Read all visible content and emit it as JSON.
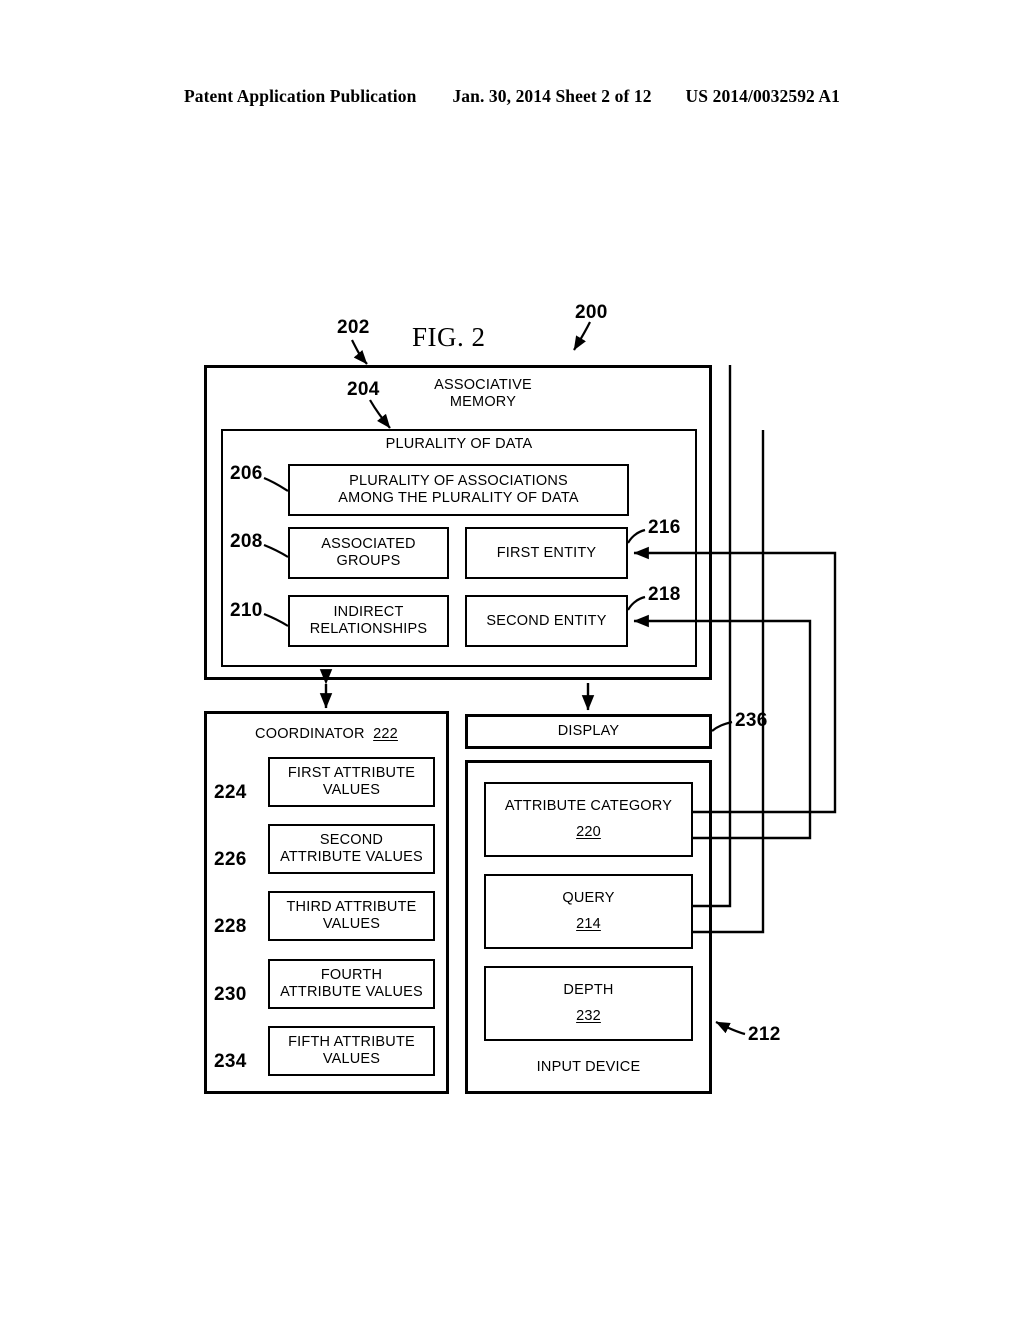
{
  "header": {
    "publication": "Patent Application Publication",
    "date_sheet": "Jan. 30, 2014  Sheet 2 of 12",
    "patent_number": "US 2014/0032592 A1"
  },
  "figure": {
    "title": "FIG. 2",
    "system_ref": "200",
    "outer_ref": "202"
  },
  "memory": {
    "ref": "204",
    "title": "ASSOCIATIVE\nMEMORY",
    "data_title": "PLURALITY OF DATA",
    "associations": {
      "ref": "206",
      "label": "PLURALITY OF ASSOCIATIONS\nAMONG THE PLURALITY OF DATA"
    },
    "associated_groups": {
      "ref": "208",
      "label": "ASSOCIATED\nGROUPS"
    },
    "indirect_relationships": {
      "ref": "210",
      "label": "INDIRECT\nRELATIONSHIPS"
    },
    "first_entity": {
      "ref": "216",
      "label": "FIRST ENTITY"
    },
    "second_entity": {
      "ref": "218",
      "label": "SECOND ENTITY"
    }
  },
  "coordinator": {
    "title": "COORDINATOR",
    "ref": "222",
    "attributes": [
      {
        "ref": "224",
        "label": "FIRST ATTRIBUTE\nVALUES"
      },
      {
        "ref": "226",
        "label": "SECOND\nATTRIBUTE VALUES"
      },
      {
        "ref": "228",
        "label": "THIRD ATTRIBUTE\nVALUES"
      },
      {
        "ref": "230",
        "label": "FOURTH\nATTRIBUTE VALUES"
      },
      {
        "ref": "234",
        "label": "FIFTH ATTRIBUTE\nVALUES"
      }
    ]
  },
  "display": {
    "label": "DISPLAY",
    "ref": "236"
  },
  "input_device": {
    "label": "INPUT DEVICE",
    "ref": "212",
    "fields": [
      {
        "label": "ATTRIBUTE CATEGORY",
        "ref": "220"
      },
      {
        "label": "QUERY",
        "ref": "214"
      },
      {
        "label": "DEPTH",
        "ref": "232"
      }
    ]
  },
  "colors": {
    "ink": "#000000",
    "paper": "#ffffff"
  }
}
